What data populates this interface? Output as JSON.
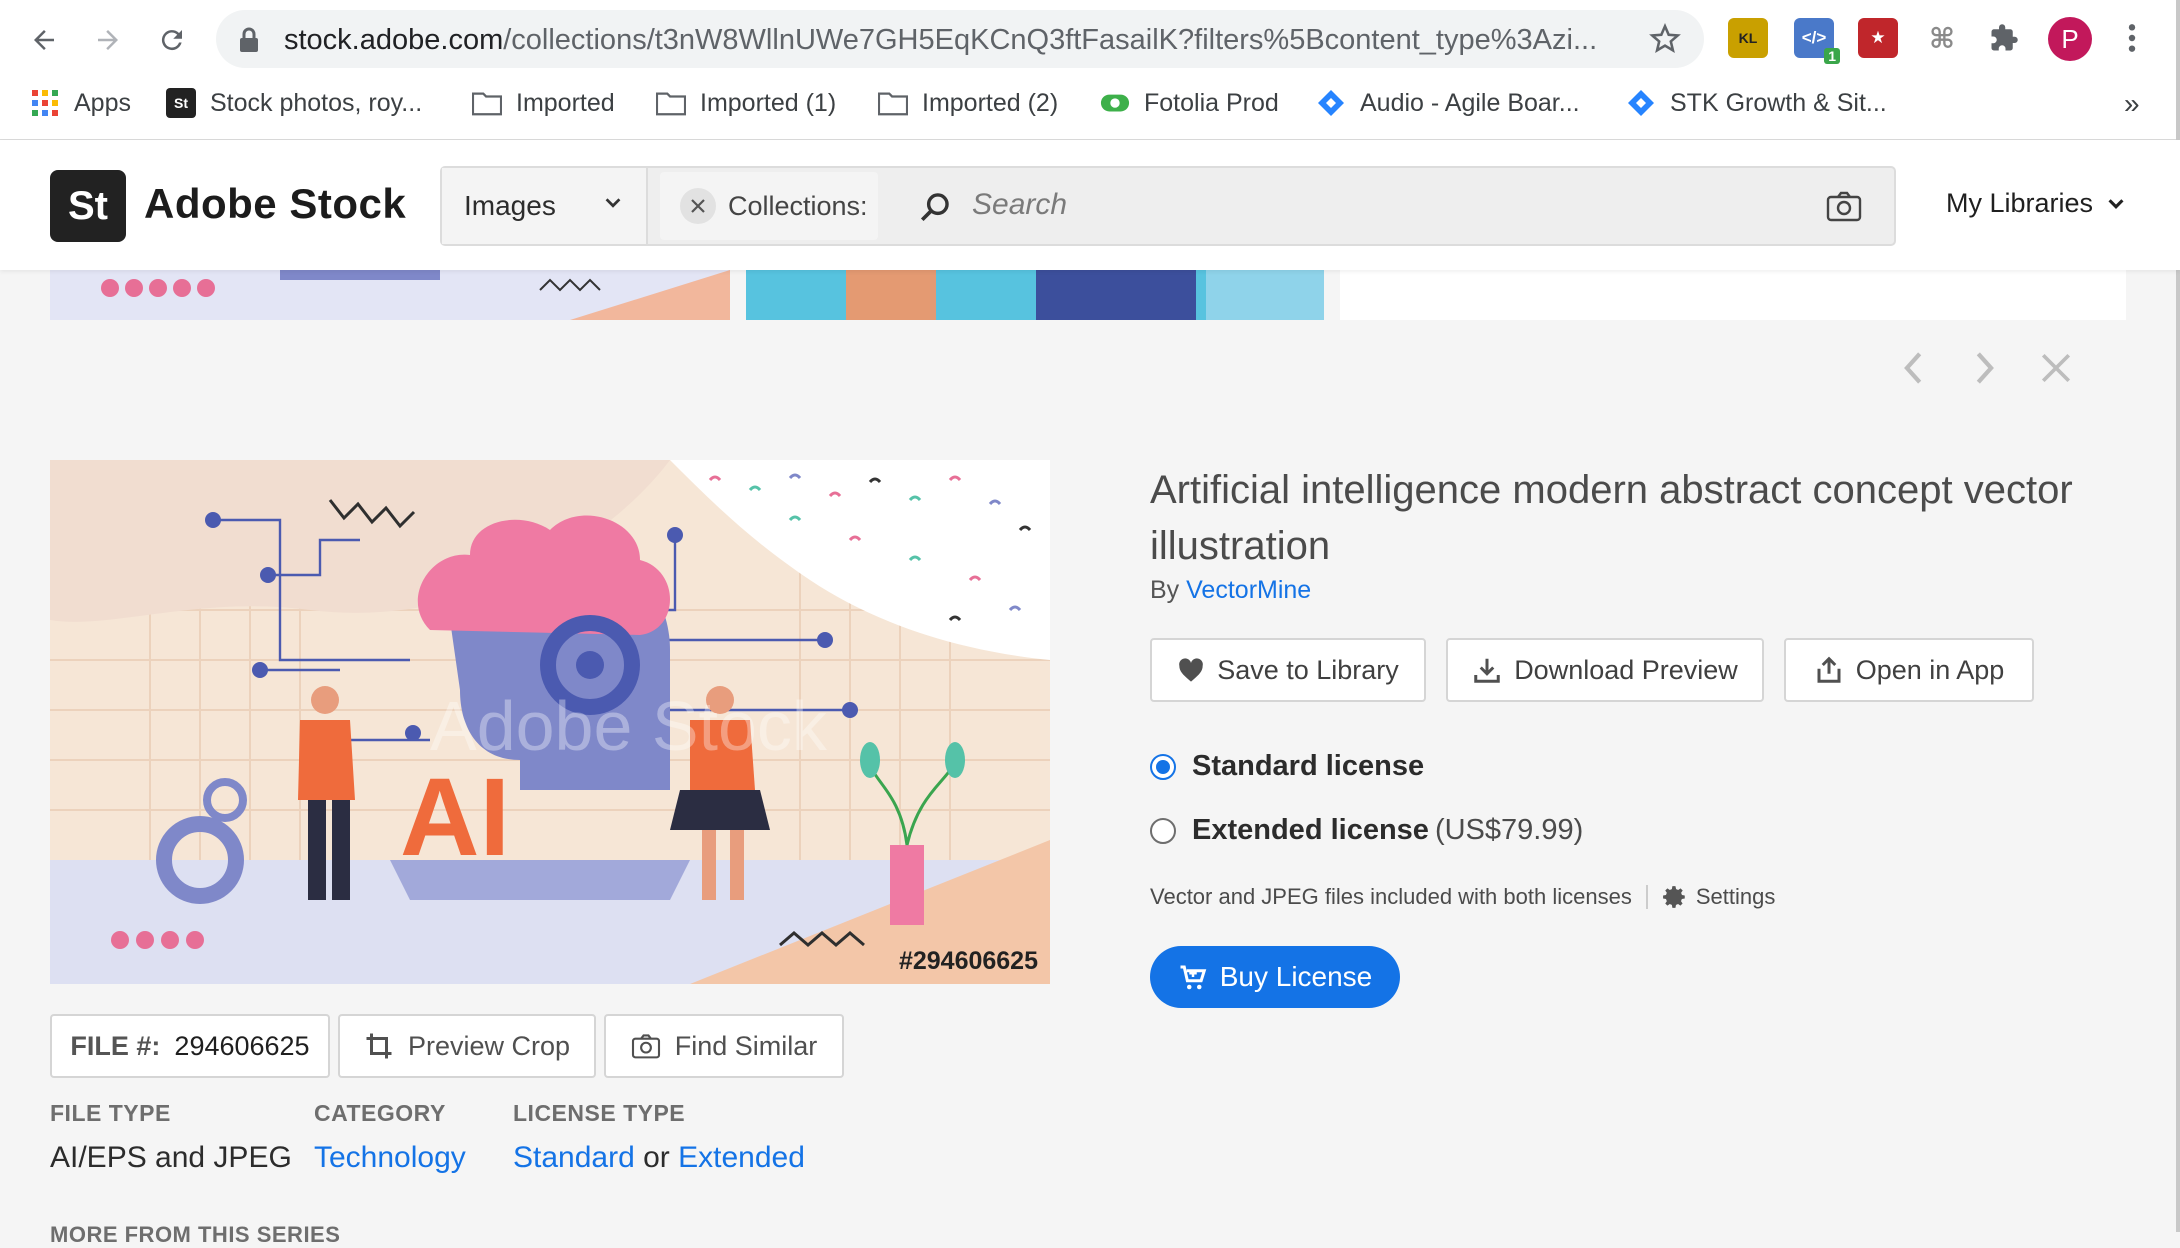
{
  "browser": {
    "url_host": "stock.adobe.com",
    "url_path": "/collections/t3nW8WllnUWe7GH5EqKCnQ3ftFasailK?filters%5Bcontent_type%3Azi...",
    "profile_initial": "P",
    "extension_badge": "1",
    "ext_kl_label": "KL",
    "bookmarks": [
      {
        "label": "Apps",
        "icon": "apps-grid-icon"
      },
      {
        "label": "Stock photos, roy...",
        "icon": "adobe-stock-icon"
      },
      {
        "label": "Imported",
        "icon": "folder-icon"
      },
      {
        "label": "Imported (1)",
        "icon": "folder-icon"
      },
      {
        "label": "Imported (2)",
        "icon": "folder-icon"
      },
      {
        "label": "Fotolia Prod",
        "icon": "fotolia-icon"
      },
      {
        "label": "Audio - Agile Boar...",
        "icon": "jira-icon"
      },
      {
        "label": "STK Growth & Sit...",
        "icon": "jira-icon"
      }
    ],
    "overflow": "»"
  },
  "header": {
    "logo_mark": "St",
    "logo_text": "Adobe Stock",
    "content_type": "Images",
    "collections_chip": "Collections:",
    "search_placeholder": "Search",
    "my_libraries": "My Libraries"
  },
  "asset": {
    "title": "Artificial intelligence modern abstract concept vector illustration",
    "by_prefix": "By",
    "author": "VectorMine",
    "watermark": "Adobe Stock",
    "image_file_id": "#294606625",
    "image_ai_text": "AI",
    "actions": {
      "save": "Save to Library",
      "download": "Download Preview",
      "open": "Open in App"
    },
    "licenses": {
      "standard": "Standard license",
      "extended": "Extended license",
      "extended_price": "(US$79.99)",
      "selected": "standard"
    },
    "included_note": "Vector and JPEG files included with both licenses",
    "settings": "Settings",
    "buy": "Buy License",
    "file_label": "FILE #:",
    "file_number": "294606625",
    "preview_crop": "Preview Crop",
    "find_similar": "Find Similar",
    "meta": {
      "file_type_h": "FILE TYPE",
      "file_type_v": "AI/EPS and JPEG",
      "category_h": "CATEGORY",
      "category_v": "Technology",
      "license_type_h": "LICENSE TYPE",
      "license_standard": "Standard",
      "license_or": "or",
      "license_extended": "Extended"
    },
    "more_series": "MORE FROM THIS SERIES"
  },
  "colors": {
    "accent": "#1473e6",
    "illustration_pink": "#e76f96",
    "illustration_purple": "#7f88c9",
    "illustration_peach": "#f3c6a8"
  }
}
